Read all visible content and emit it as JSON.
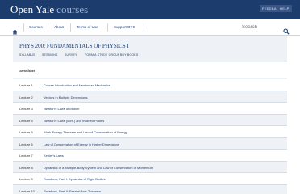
{
  "header": {
    "logo_main": "Open Yale",
    "logo_sub": "courses",
    "feedback_label": "FEEDBACK",
    "help_label": "HELP"
  },
  "nav": {
    "home_icon": "home-icon",
    "courses": "Courses",
    "about": "About",
    "terms": "Terms of Use",
    "support": "Support OYC",
    "search_placeholder": "Search",
    "search_icon": "search-icon"
  },
  "course": {
    "title": "PHYS 200: FUNDAMENTALS OF PHYSICS I",
    "tabs": [
      "SYLLABUS",
      "SESSIONS",
      "SURVEY",
      "FORM A STUDY GROUP",
      "BUY BOOKS"
    ]
  },
  "sessions": {
    "heading": "Sessions",
    "lectures": [
      {
        "num": "Lecture 1",
        "title": "Course Introduction and Newtonian Mechanics"
      },
      {
        "num": "Lecture 2",
        "title": "Vectors in Multiple Dimensions"
      },
      {
        "num": "Lecture 3",
        "title": "Newton's Laws of Motion"
      },
      {
        "num": "Lecture 4",
        "title": "Newton's Laws (cont.) and Inclined Planes"
      },
      {
        "num": "Lecture 5",
        "title": "Work-Energy Theorem and Law of Conservation of Energy"
      },
      {
        "num": "Lecture 6",
        "title": "Law of Conservation of Energy in Higher Dimensions"
      },
      {
        "num": "Lecture 7",
        "title": "Kepler's Laws"
      },
      {
        "num": "Lecture 8",
        "title": "Dynamics of a Multiple-Body System and Law of Conservation of Momentum"
      },
      {
        "num": "Lecture 9",
        "title": "Rotations, Part I: Dynamics of Rigid Bodies"
      },
      {
        "num": "Lecture 10",
        "title": "Rotations, Part II: Parallel Axis Theorem"
      }
    ]
  },
  "colors": {
    "brand": "#1d3c6e",
    "row_alt": "#eef1f5"
  }
}
